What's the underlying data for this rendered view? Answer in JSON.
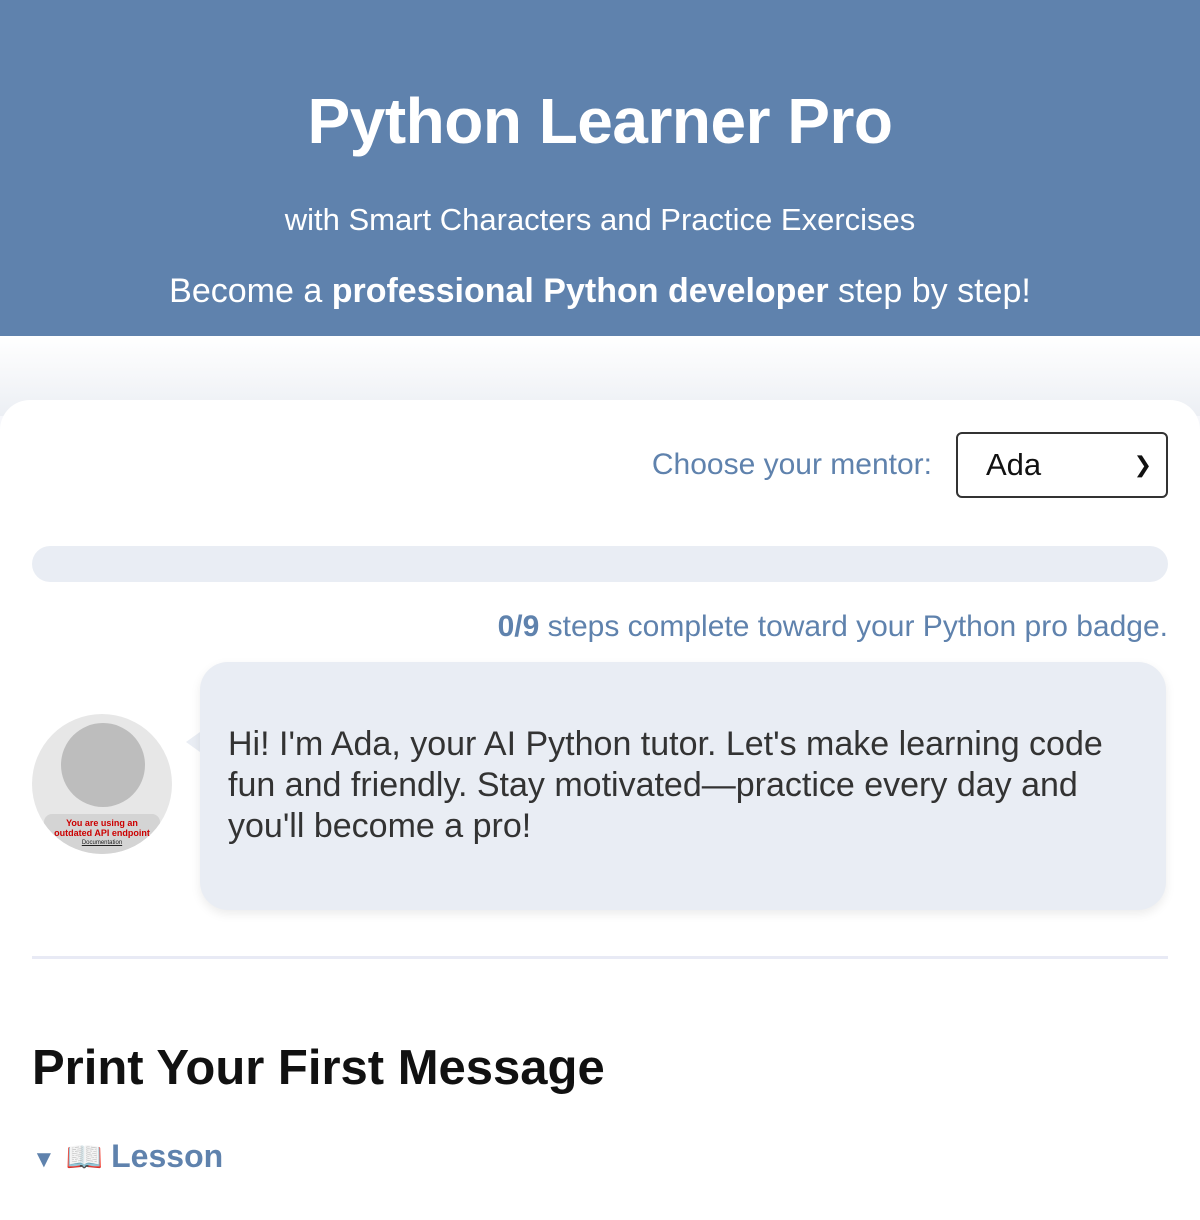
{
  "header": {
    "title": "Python Learner Pro",
    "subtitle": "with Smart Characters and Practice Exercises",
    "tagline_pre": "Become a ",
    "tagline_bold": "professional Python developer",
    "tagline_post": " step by step!",
    "bg_color": "#5f82ad"
  },
  "mentor": {
    "label": "Choose your mentor:",
    "selected": "Ada"
  },
  "progress": {
    "completed": "0/9",
    "text": " steps complete toward your Python pro badge.",
    "fraction": 0
  },
  "tutor": {
    "message": "Hi! I'm Ada, your AI Python tutor. Let's make learning code fun and friendly. Stay motivated—practice every day and you'll become a pro!",
    "avatar_warning_line1": "You are using an",
    "avatar_warning_line2": "outdated API endpoint",
    "avatar_warning_link": "Documentation"
  },
  "lesson": {
    "title": "Print Your First Message",
    "toggle_label": "Lesson",
    "toggle_icon": "open-book-icon"
  }
}
